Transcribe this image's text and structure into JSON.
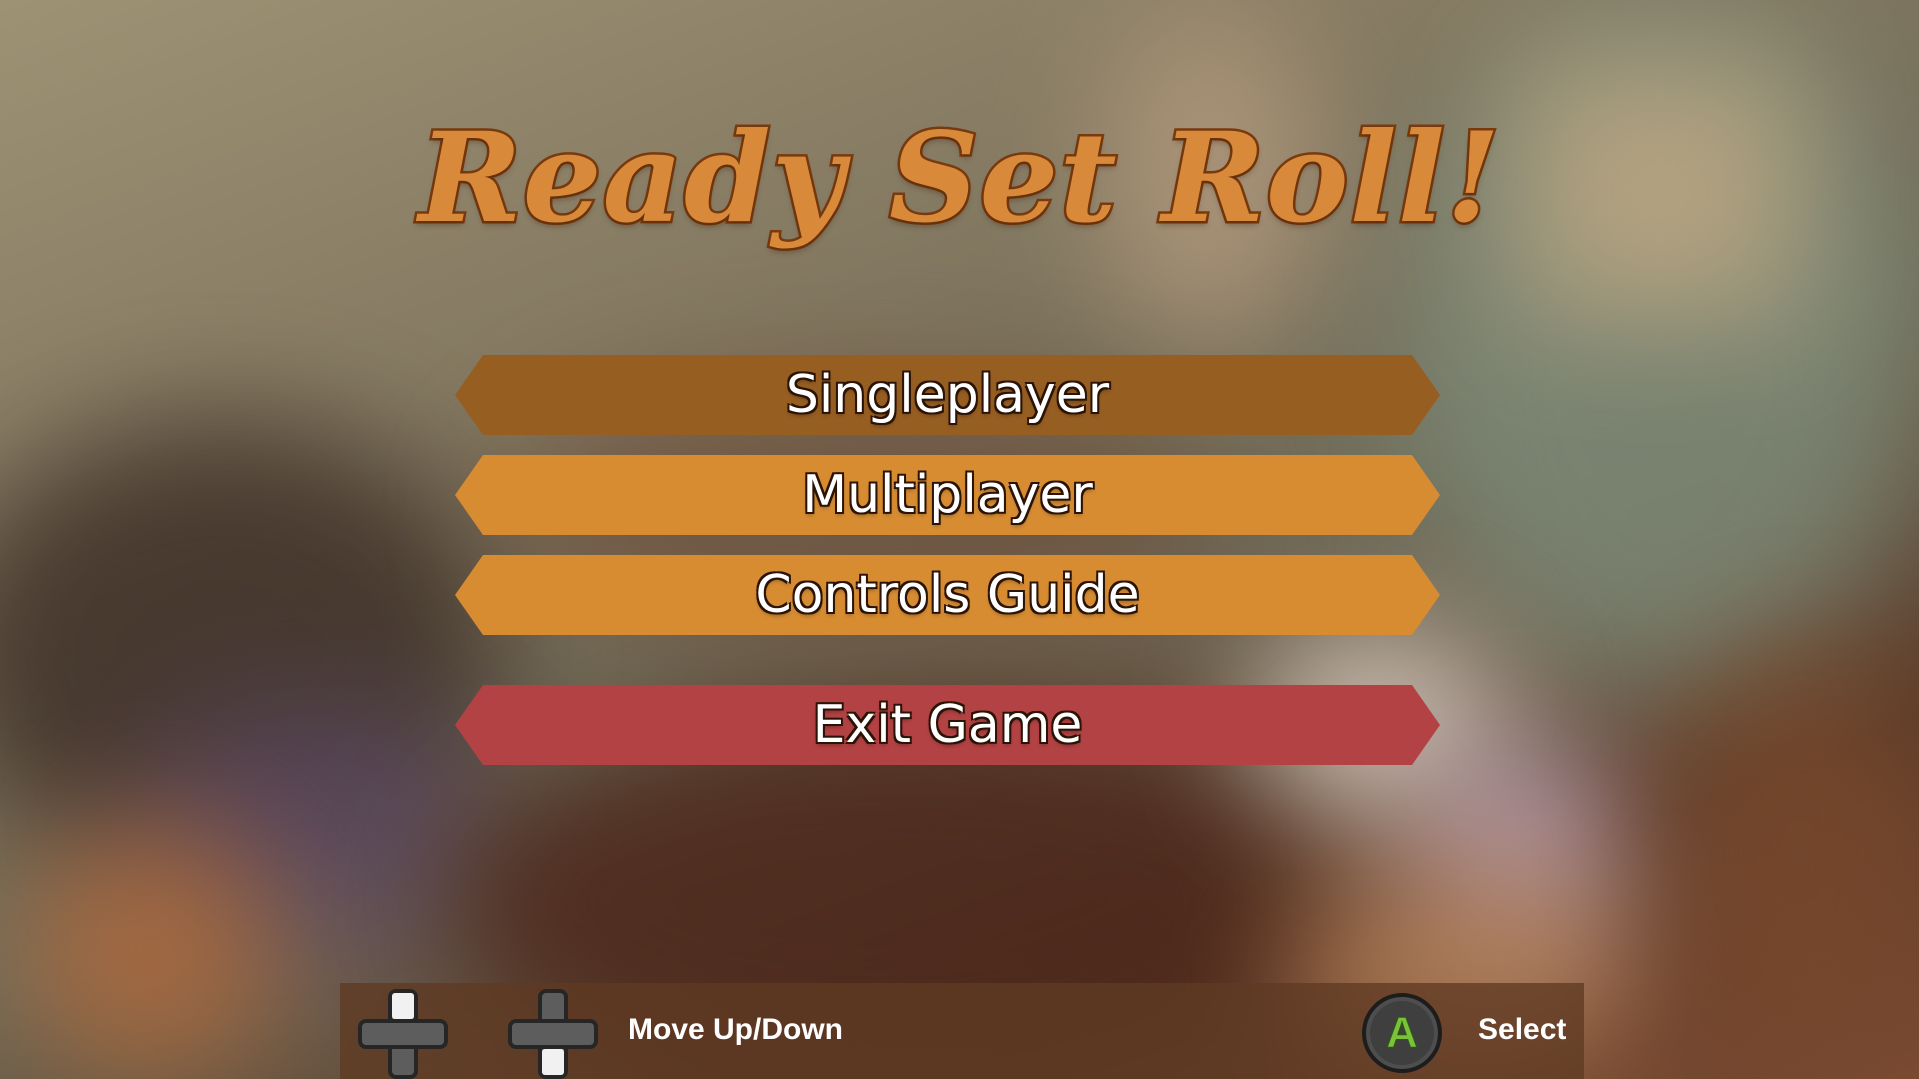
{
  "game": {
    "title": "Ready Set Roll!"
  },
  "menu": {
    "items": [
      {
        "label": "Singleplayer",
        "state": "selected"
      },
      {
        "label": "Multiplayer",
        "state": "normal"
      },
      {
        "label": "Controls Guide",
        "state": "normal"
      },
      {
        "label": "Exit Game",
        "state": "exit"
      }
    ]
  },
  "hints": {
    "move_label": "Move Up/Down",
    "move_icons": [
      "dpad-up-icon",
      "dpad-down-icon"
    ],
    "select_button": "A",
    "select_label": "Select",
    "select_icon": "a-button-icon"
  },
  "colors": {
    "title_fill": "#d9893a",
    "title_outline": "#7a3b0e",
    "button_selected": "#975e22",
    "button_normal": "#d78c32",
    "button_exit": "#b34244",
    "a_button_letter": "#79c23a"
  }
}
